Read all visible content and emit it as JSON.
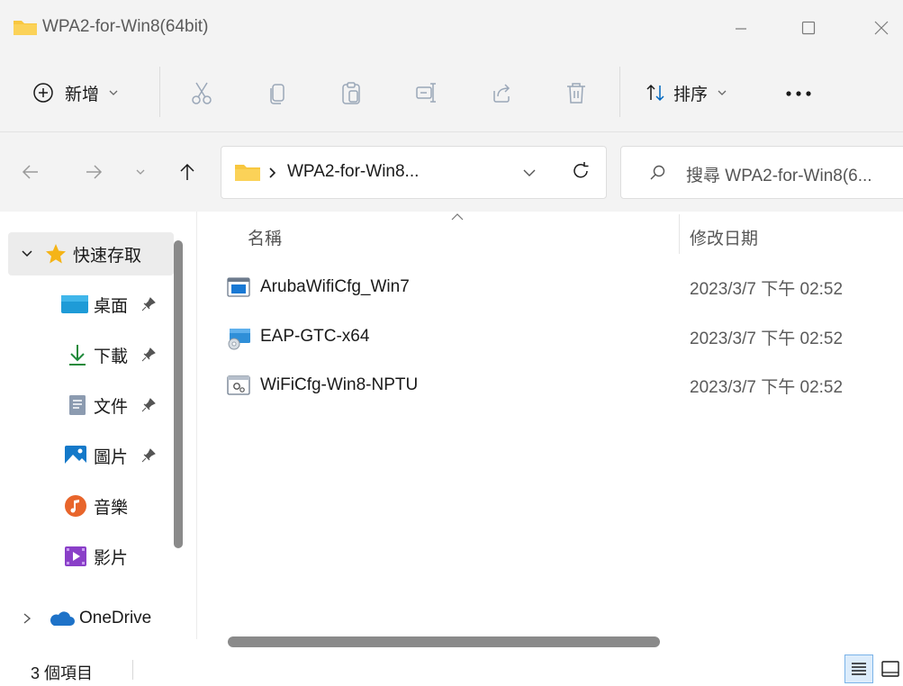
{
  "window": {
    "title": "WPA2-for-Win8(64bit)"
  },
  "toolbar": {
    "new_label": "新增",
    "sort_label": "排序"
  },
  "address": {
    "path_label": "WPA2-for-Win8...",
    "search_placeholder": "搜尋 WPA2-for-Win8(6..."
  },
  "sidebar": {
    "quick_access": "快速存取",
    "items": [
      {
        "label": "桌面",
        "icon": "desktop-icon",
        "pinned": true
      },
      {
        "label": "下載",
        "icon": "download-icon",
        "pinned": true
      },
      {
        "label": "文件",
        "icon": "documents-icon",
        "pinned": true
      },
      {
        "label": "圖片",
        "icon": "pictures-icon",
        "pinned": true
      },
      {
        "label": "音樂",
        "icon": "music-icon",
        "pinned": false
      },
      {
        "label": "影片",
        "icon": "videos-icon",
        "pinned": false
      }
    ],
    "onedrive": "OneDrive"
  },
  "columns": {
    "name": "名稱",
    "modified": "修改日期"
  },
  "files": [
    {
      "name": "ArubaWifiCfg_Win7",
      "modified": "2023/3/7 下午 02:52",
      "icon": "application-icon"
    },
    {
      "name": "EAP-GTC-x64",
      "modified": "2023/3/7 下午 02:52",
      "icon": "installer-icon"
    },
    {
      "name": "WiFiCfg-Win8-NPTU",
      "modified": "2023/3/7 下午 02:52",
      "icon": "settings-file-icon"
    }
  ],
  "status": {
    "count": "3 個項目"
  },
  "colors": {
    "chrome": "#f3f3f3",
    "folder": "#f8c73f",
    "star": "#f5b417",
    "onedrive": "#1e72c8",
    "accent": "#0078d4"
  }
}
